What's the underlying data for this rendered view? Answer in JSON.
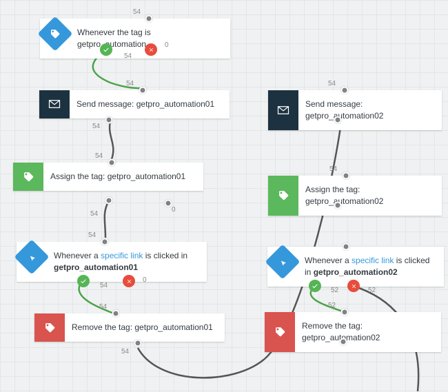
{
  "icons": {
    "tag": "tag-icon",
    "envelope": "envelope-icon",
    "cursor": "cursor-click-icon",
    "check": "check-icon",
    "close": "close-icon"
  },
  "colors": {
    "blue_diamond": "#3598db",
    "dark_navy": "#1d3240",
    "green": "#5cb85c",
    "red": "#d9534f",
    "link": "#3598db",
    "connector_default": "#555",
    "connector_yes": "#4aa34a"
  },
  "nodes": {
    "trigger1": {
      "label": "Whenever the tag is getpro_automation",
      "in_label": "54",
      "out_yes": "54",
      "out_no": "0"
    },
    "send1": {
      "label": "Send message: getpro_automation01",
      "in_label": "54",
      "out_label": "54"
    },
    "send2": {
      "label": "Send message: getpro_automation02",
      "in_label": "54",
      "out_label": ""
    },
    "assign1": {
      "label": "Assign the tag: getpro_automation01",
      "in_label": "54",
      "out_left": "54",
      "out_right": "0"
    },
    "assign2": {
      "label": "Assign the tag: getpro_automation02",
      "in_label": "54"
    },
    "click1": {
      "prefix": "Whenever a ",
      "link": "specific link",
      "suffix": " is clicked in ",
      "bold": "getpro_automation01",
      "in_label": "54",
      "out_yes": "54",
      "out_no": "0"
    },
    "click2": {
      "prefix": "Whenever a ",
      "link": "specific link",
      "suffix": " is clicked in ",
      "bold": "getpro_automation02",
      "in_label": "",
      "out_yes": "52",
      "out_no": "52"
    },
    "remove1": {
      "label": "Remove the tag: getpro_automation01",
      "in_label": "54",
      "out_label": "54"
    },
    "remove2": {
      "label": "Remove the tag: getpro_automation02",
      "in_label": "52"
    }
  }
}
